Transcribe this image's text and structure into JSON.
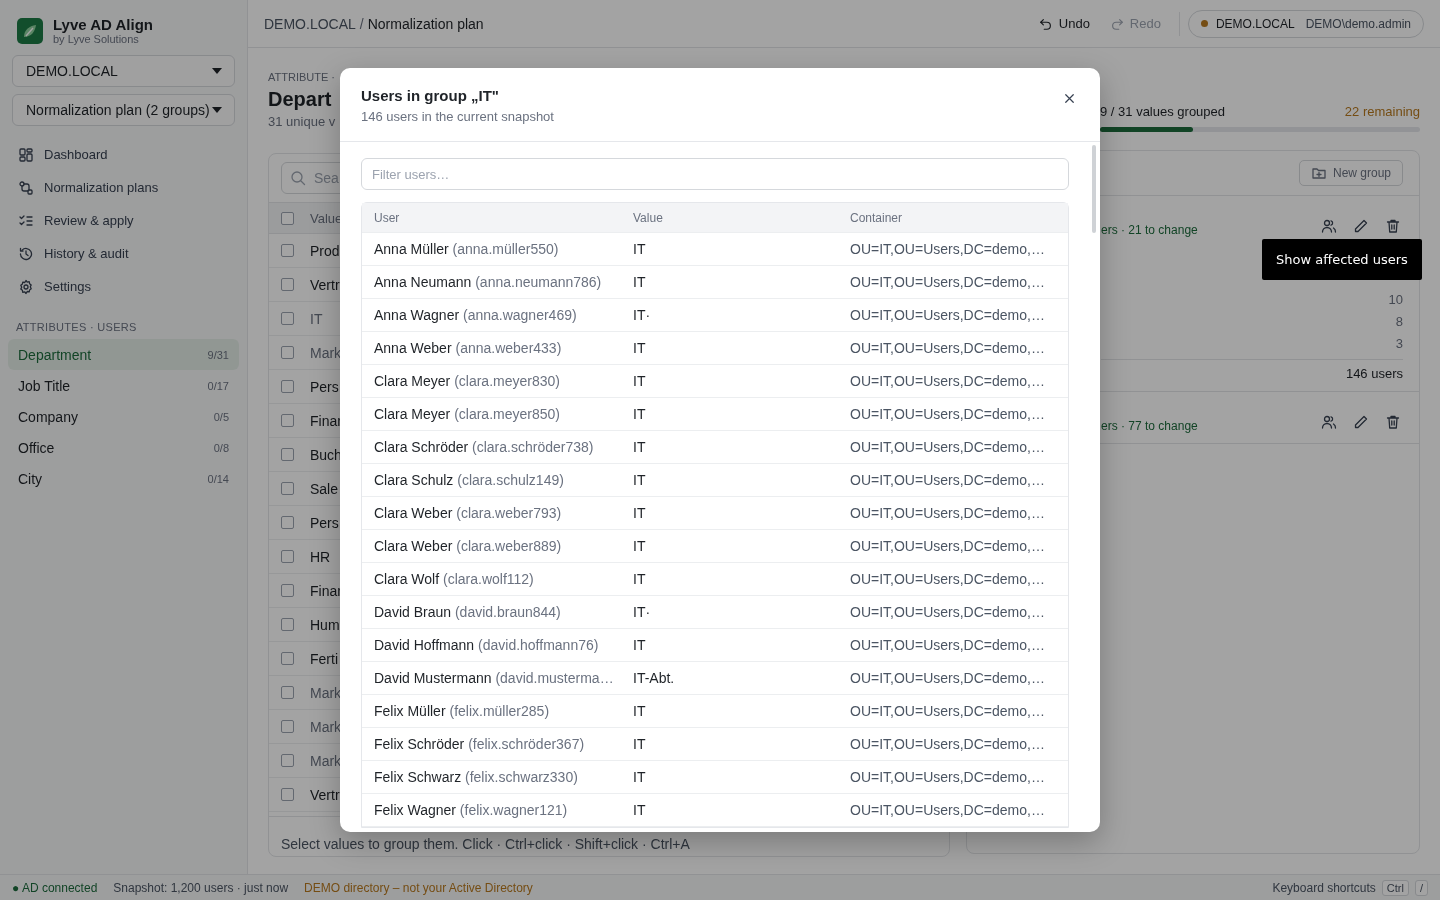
{
  "app": {
    "name": "Lyve AD Align",
    "vendor": "by Lyve Solutions"
  },
  "sidebar": {
    "domain_select": "DEMO.LOCAL",
    "plan_select": "Normalization plan (2 groups)",
    "nav": [
      {
        "label": "Dashboard"
      },
      {
        "label": "Normalization plans"
      },
      {
        "label": "Review & apply"
      },
      {
        "label": "History & audit"
      },
      {
        "label": "Settings"
      }
    ],
    "section": "ATTRIBUTES · USERS",
    "attributes": [
      {
        "label": "Department",
        "count": "9/31",
        "selected": true
      },
      {
        "label": "Job Title",
        "count": "0/17",
        "selected": false
      },
      {
        "label": "Company",
        "count": "0/5",
        "selected": false
      },
      {
        "label": "Office",
        "count": "0/8",
        "selected": false
      },
      {
        "label": "City",
        "count": "0/14",
        "selected": false
      }
    ]
  },
  "topbar": {
    "breadcrumb": [
      "DEMO.LOCAL",
      "Normalization plan"
    ],
    "breadcrumb_separator": "/",
    "undo": {
      "label": "Undo",
      "disabled": false
    },
    "redo": {
      "label": "Redo",
      "disabled": true
    },
    "domain": "DEMO.LOCAL",
    "account": "DEMO\\demo.admin"
  },
  "values_panel": {
    "eyebrow": "ATTRIBUTE ·",
    "title": "Depart",
    "subtitle": "31 unique v",
    "search_placeholder": "Sea",
    "column": "Value",
    "header_checked": false,
    "rows": [
      {
        "value": "Prod",
        "grouped": false,
        "checked": false
      },
      {
        "value": "Vertr",
        "grouped": false,
        "checked": false
      },
      {
        "value": "IT",
        "grouped": true,
        "checked": false
      },
      {
        "value": "Mark",
        "grouped": true,
        "checked": false
      },
      {
        "value": "Pers",
        "grouped": false,
        "checked": false
      },
      {
        "value": "Finar",
        "grouped": false,
        "checked": false
      },
      {
        "value": "Buch",
        "grouped": false,
        "checked": false
      },
      {
        "value": "Sale",
        "grouped": false,
        "checked": false
      },
      {
        "value": "Pers",
        "grouped": false,
        "checked": false
      },
      {
        "value": "HR",
        "grouped": false,
        "checked": false
      },
      {
        "value": "Finar",
        "grouped": false,
        "checked": false
      },
      {
        "value": "Hum",
        "grouped": false,
        "checked": false
      },
      {
        "value": "Ferti",
        "grouped": false,
        "checked": false
      },
      {
        "value": "Mark",
        "grouped": true,
        "checked": false
      },
      {
        "value": "Mark",
        "grouped": true,
        "checked": false
      },
      {
        "value": "Mark",
        "grouped": true,
        "checked": false
      },
      {
        "value": "Vertr",
        "grouped": false,
        "checked": false
      }
    ],
    "footer": "Select values to group them. Click · Ctrl+click · Shift+click · Ctrl+A"
  },
  "groups_panel": {
    "progress": "9 / 31 values grouped",
    "remaining": "22 remaining",
    "level": 0.29,
    "new_group": "New group",
    "groups": [
      {
        "summary": "ers · 21 to change",
        "counts": [
          "10",
          "8",
          "3"
        ],
        "total": "146 users"
      },
      {
        "summary": "ers · 77 to change"
      }
    ]
  },
  "tooltip": "Show affected users",
  "modal": {
    "title": "Users in group „IT\"",
    "subtitle": "146 users in the current snapshot",
    "filter_placeholder": "Filter users…",
    "columns": [
      "User",
      "Value",
      "Container"
    ],
    "rows": [
      {
        "name": "Anna Müller",
        "login": "(anna.müller550)",
        "value": "IT",
        "container": "OU=IT,OU=Users,DC=demo,…"
      },
      {
        "name": "Anna Neumann",
        "login": "(anna.neumann786)",
        "value": "IT",
        "container": "OU=IT,OU=Users,DC=demo,…"
      },
      {
        "name": "Anna Wagner",
        "login": "(anna.wagner469)",
        "value": "IT·",
        "container": "OU=IT,OU=Users,DC=demo,…"
      },
      {
        "name": "Anna Weber",
        "login": "(anna.weber433)",
        "value": "IT",
        "container": "OU=IT,OU=Users,DC=demo,…"
      },
      {
        "name": "Clara Meyer",
        "login": "(clara.meyer830)",
        "value": "IT",
        "container": "OU=IT,OU=Users,DC=demo,…"
      },
      {
        "name": "Clara Meyer",
        "login": "(clara.meyer850)",
        "value": "IT",
        "container": "OU=IT,OU=Users,DC=demo,…"
      },
      {
        "name": "Clara Schröder",
        "login": "(clara.schröder738)",
        "value": "IT",
        "container": "OU=IT,OU=Users,DC=demo,…"
      },
      {
        "name": "Clara Schulz",
        "login": "(clara.schulz149)",
        "value": "IT",
        "container": "OU=IT,OU=Users,DC=demo,…"
      },
      {
        "name": "Clara Weber",
        "login": "(clara.weber793)",
        "value": "IT",
        "container": "OU=IT,OU=Users,DC=demo,…"
      },
      {
        "name": "Clara Weber",
        "login": "(clara.weber889)",
        "value": "IT",
        "container": "OU=IT,OU=Users,DC=demo,…"
      },
      {
        "name": "Clara Wolf",
        "login": "(clara.wolf112)",
        "value": "IT",
        "container": "OU=IT,OU=Users,DC=demo,…"
      },
      {
        "name": "David Braun",
        "login": "(david.braun844)",
        "value": "IT·",
        "container": "OU=IT,OU=Users,DC=demo,…"
      },
      {
        "name": "David Hoffmann",
        "login": "(david.hoffmann76)",
        "value": "IT",
        "container": "OU=IT,OU=Users,DC=demo,…"
      },
      {
        "name": "David Mustermann",
        "login": "(david.musterma…",
        "value": "IT-Abt.",
        "container": "OU=IT,OU=Users,DC=demo,…"
      },
      {
        "name": "Felix Müller",
        "login": "(felix.müller285)",
        "value": "IT",
        "container": "OU=IT,OU=Users,DC=demo,…"
      },
      {
        "name": "Felix Schröder",
        "login": "(felix.schröder367)",
        "value": "IT",
        "container": "OU=IT,OU=Users,DC=demo,…"
      },
      {
        "name": "Felix Schwarz",
        "login": "(felix.schwarz330)",
        "value": "IT",
        "container": "OU=IT,OU=Users,DC=demo,…"
      },
      {
        "name": "Felix Wagner",
        "login": "(felix.wagner121)",
        "value": "IT",
        "container": "OU=IT,OU=Users,DC=demo,…"
      }
    ]
  },
  "status_bar": {
    "connection": "● AD connected",
    "snapshot": "Snapshot: 1,200 users · just now",
    "warning": "DEMO directory – not your Active Directory",
    "shortcuts": "Keyboard shortcuts",
    "keys": [
      "Ctrl",
      "/"
    ]
  }
}
